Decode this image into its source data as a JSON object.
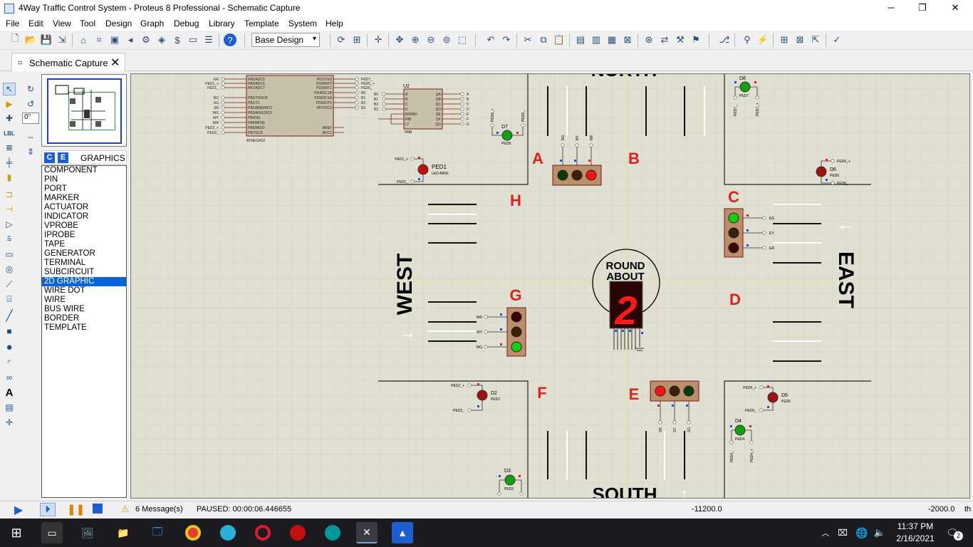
{
  "window": {
    "title": "4Way Traffic Control System - Proteus 8 Professional - Schematic Capture",
    "minimize": "─",
    "restore": "❐",
    "close": "✕"
  },
  "menu": [
    "File",
    "Edit",
    "View",
    "Tool",
    "Design",
    "Graph",
    "Debug",
    "Library",
    "Template",
    "System",
    "Help"
  ],
  "toolbar": {
    "design_select": "Base Design",
    "select_arrow": "▾"
  },
  "tab": {
    "label": "Schematic Capture",
    "close": "✕"
  },
  "rotation_value": "0°",
  "device_panel": {
    "c_label": "C",
    "e_label": "E",
    "title": "GRAPHICS",
    "items": [
      "COMPONENT",
      "PIN",
      "PORT",
      "MARKER",
      "ACTUATOR",
      "INDICATOR",
      "VPROBE",
      "IPROBE",
      "TAPE",
      "GENERATOR",
      "TERMINAL",
      "SUBCIRCUIT",
      "2D GRAPHIC",
      "WIRE DOT",
      "WIRE",
      "BUS WIRE",
      "BORDER",
      "TEMPLATE"
    ],
    "selected": "2D GRAPHIC"
  },
  "schematic": {
    "directions": {
      "north": "NORTH",
      "south": "SOUTH",
      "west": "WEST",
      "east": "EAST"
    },
    "roundabout": [
      "ROUND",
      "ABOUT"
    ],
    "display_digit": "2",
    "corner_labels": [
      "A",
      "B",
      "C",
      "D",
      "E",
      "F",
      "G",
      "H"
    ],
    "mcu": {
      "name": "ATMEGA32",
      "left_pins": [
        "PA5/ADC5",
        "PA6/ADC6",
        "PA7/ADC7",
        "PB0/T0/XCK",
        "PB1/T1",
        "PB2/AIN0/INT2",
        "PB3/AIN1/OC0",
        "PB4/SS",
        "PB5/MOSI",
        "PB6/MISO",
        "PB7/SCK"
      ],
      "right_pins": [
        "PD1/TXD",
        "PD2/INT0",
        "PD3/INT1",
        "PD4/OC1B",
        "PD5/OC1A",
        "PD6/ICP1",
        "PD7/OC2",
        "AREF",
        "AVCC"
      ],
      "left_nets": [
        "ER",
        "PED1_+",
        "PED1_",
        "BG",
        "SG",
        "SR",
        "WG",
        "WY",
        "WR",
        "PED2_+",
        "PED2_"
      ],
      "right_nets": [
        "PED7_",
        "PED5_+",
        "PED5_",
        "B0",
        "B1",
        "B2",
        "B3"
      ]
    },
    "decoder": {
      "ref": "U2",
      "name": "7448",
      "left_pins": [
        "A",
        "B",
        "C",
        "D",
        "BI/RBO",
        "RBI",
        "LT"
      ],
      "right_pins": [
        "QA",
        "QB",
        "QC",
        "QD",
        "QE",
        "QF",
        "QG"
      ],
      "left_nets": [
        "B0",
        "B1",
        "B2",
        "B3"
      ],
      "right_nets": [
        "A",
        "B",
        "C",
        "D",
        "E",
        "F",
        "G"
      ]
    },
    "light_nets": {
      "north": [
        "NG",
        "NY",
        "NR"
      ],
      "east": [
        "EG",
        "EY",
        "ER"
      ],
      "west": [
        "WR",
        "WY",
        "WG"
      ],
      "south": [
        "SR",
        "SY",
        "SG"
      ]
    },
    "ped_leds": [
      {
        "ref": "PED1",
        "sub": "LED-BIRG",
        "pos": "PED1_+",
        "neg": "PED1_"
      },
      {
        "ref": "D7",
        "sub": "PED8",
        "pos": "PED8_+",
        "neg": "PED8_"
      },
      {
        "ref": "D8",
        "sub": "PED7",
        "pos": "PED7_+",
        "neg": "PED7_"
      },
      {
        "ref": "D6",
        "sub": "PED6",
        "pos": "PED6_+",
        "neg": "PED6_"
      },
      {
        "ref": "D5",
        "sub": "PED5",
        "pos": "PED5_+",
        "neg": "PED5_"
      },
      {
        "ref": "D4",
        "sub": "PED4",
        "pos": "PED4_+",
        "neg": "PED4_"
      },
      {
        "ref": "D2",
        "sub": "PED2",
        "pos": "PED2_+",
        "neg": "PED2_"
      },
      {
        "ref": "D3",
        "sub": "PED3",
        "pos": "PED3_+",
        "neg": "PED3_"
      }
    ]
  },
  "status": {
    "messages": "6 Message(s)",
    "state": "PAUSED: 00:00:06.446655",
    "x_coord": "-11200.0",
    "y_coord": "-2000.0",
    "unit": "th"
  },
  "taskbar": {
    "time": "11:37 PM",
    "date": "2/16/2021",
    "notifications": "2"
  },
  "colors": {
    "canvas": "#e0e0d2",
    "component_fill": "#c8c0a8",
    "light_body": "#bb8f6c",
    "label_red": "#e0201a",
    "selection_blue": "#0a64d8"
  }
}
